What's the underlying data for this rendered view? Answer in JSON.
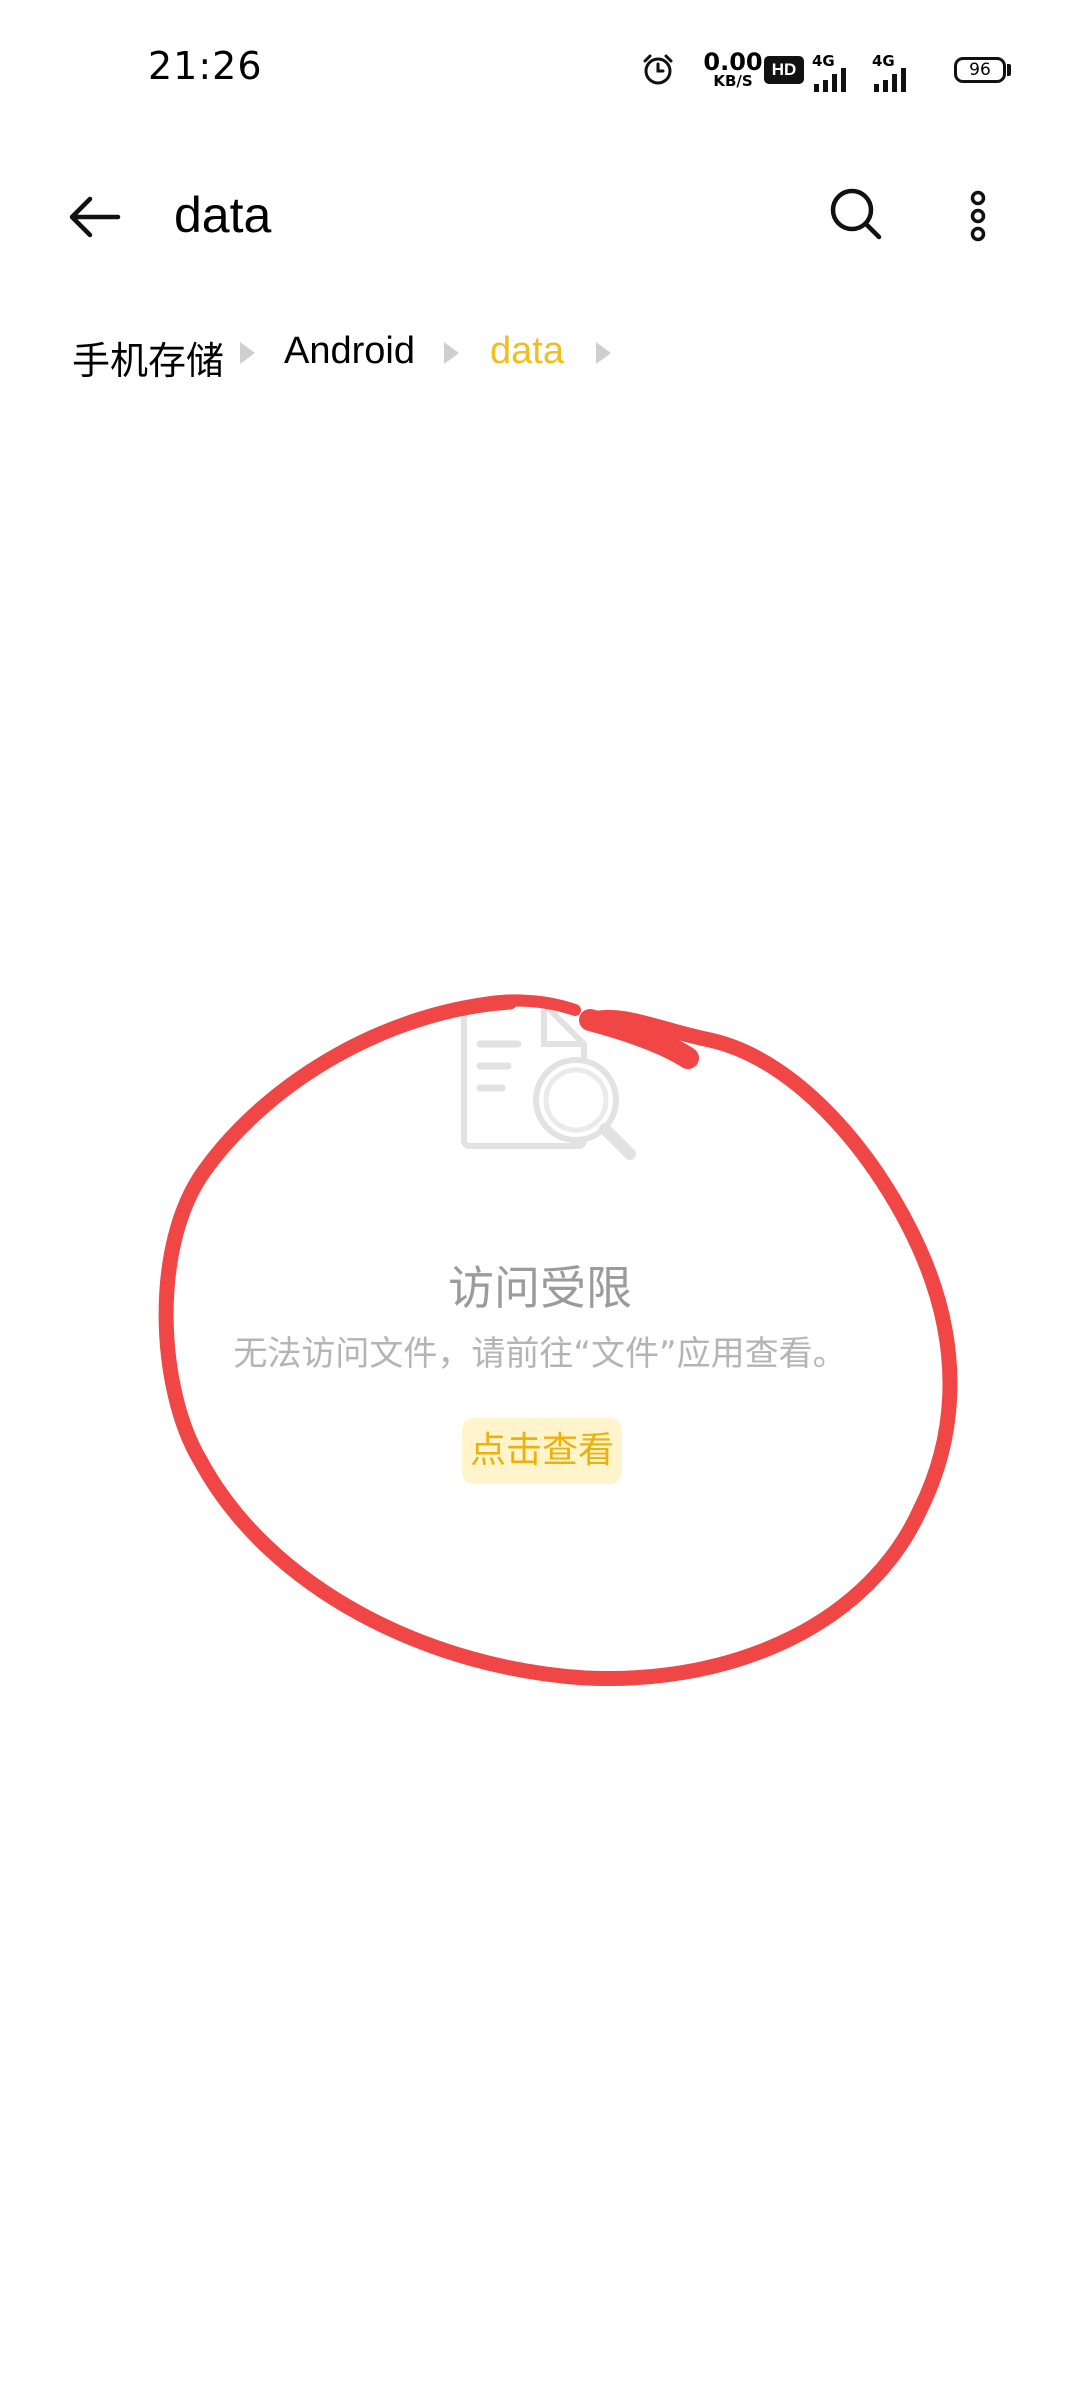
{
  "status_bar": {
    "time": "21:26",
    "net_speed_value": "0.00",
    "net_speed_unit": "KB/S",
    "hd_label": "HD",
    "signal_1_label": "4G",
    "signal_2_label": "4G",
    "battery_level": "96"
  },
  "header": {
    "title": "data"
  },
  "breadcrumb": {
    "items": [
      {
        "label": "手机存储"
      },
      {
        "label": "Android"
      },
      {
        "label": "data"
      }
    ]
  },
  "empty_state": {
    "title": "访问受限",
    "message": "无法访问文件，请前往“文件”应用查看。",
    "action_label": "点击查看"
  },
  "colors": {
    "accent": "#f0be1e",
    "annotation": "#f04646",
    "muted_text": "#9b9b9b"
  },
  "icons": [
    "alarm-icon",
    "hd-voice-icon",
    "signal-icon",
    "battery-icon",
    "back-arrow-icon",
    "search-icon",
    "more-options-icon",
    "breadcrumb-chevron-icon",
    "file-search-icon"
  ]
}
